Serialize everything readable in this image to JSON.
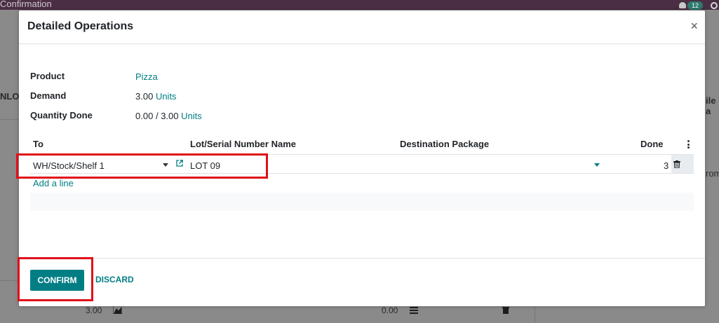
{
  "background": {
    "breadcrumb": "Confirmation",
    "badge_count": "12",
    "left_col_text": "NLO",
    "right_col_text": "ile a",
    "right_col_text2": "rom",
    "row_qty": "3.00",
    "row_value": "0.00"
  },
  "modal": {
    "title": "Detailed Operations",
    "close_label": "×",
    "fields": {
      "product_label": "Product",
      "product_value": "Pizza",
      "demand_label": "Demand",
      "demand_value": "3.00",
      "demand_unit": "Units",
      "qty_done_label": "Quantity Done",
      "qty_done_value": "0.00",
      "qty_done_sep": "/",
      "qty_done_total": "3.00",
      "qty_done_unit": "Units"
    },
    "table": {
      "columns": [
        "To",
        "Lot/Serial Number Name",
        "Destination Package",
        "Done"
      ],
      "rows": [
        {
          "to": "WH/Stock/Shelf 1",
          "lot": "LOT 09",
          "package": "",
          "done": "3"
        }
      ],
      "add_line": "Add a line"
    },
    "footer": {
      "confirm_label": "CONFIRM",
      "discard_label": "DISCARD"
    }
  },
  "colors": {
    "accent": "#017e84",
    "highlight": "#e0101a",
    "topbar": "#4a2f44"
  }
}
